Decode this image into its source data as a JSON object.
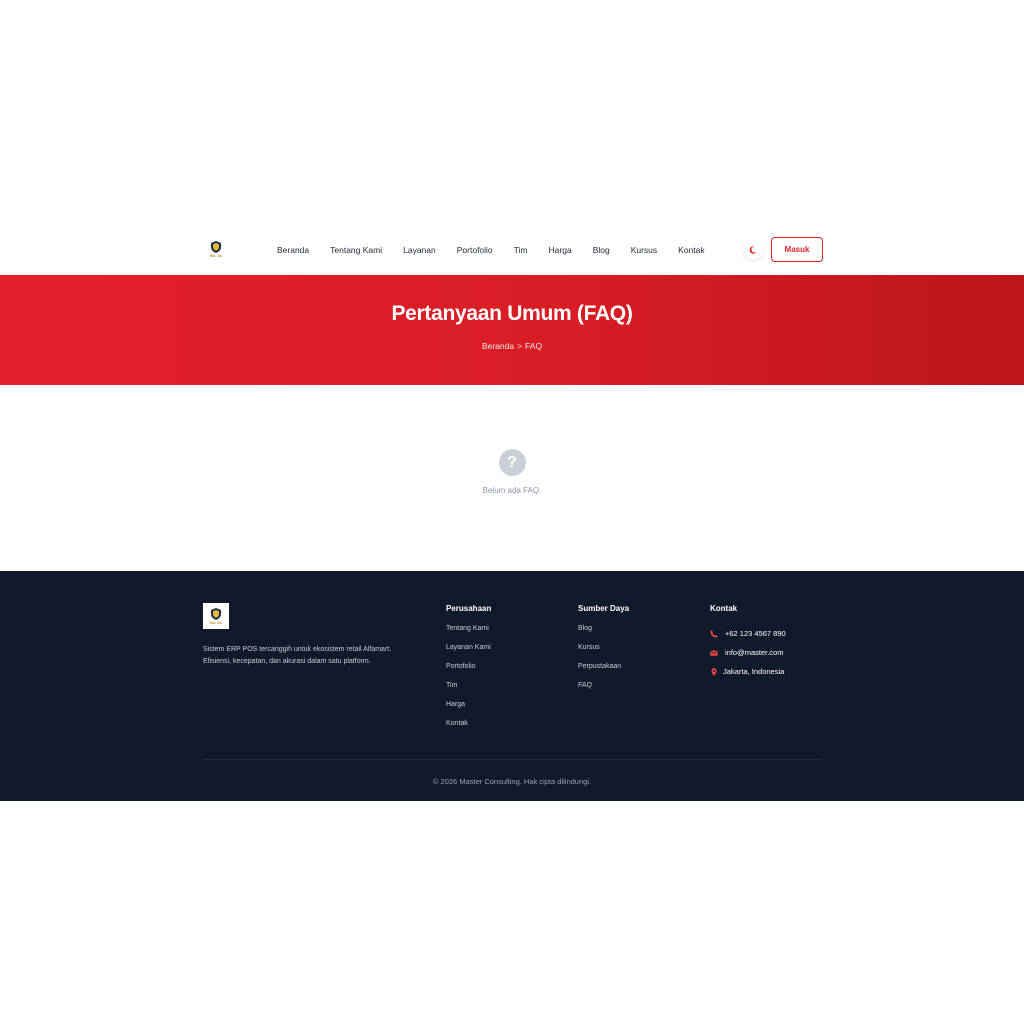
{
  "brand": {
    "logo_text": "Ba Ja"
  },
  "nav": {
    "links": [
      "Beranda",
      "Tentang Kami",
      "Layanan",
      "Portofolio",
      "Tim",
      "Harga",
      "Blog",
      "Kursus",
      "Kontak"
    ],
    "login_label": "Masuk"
  },
  "hero": {
    "title": "Pertanyaan Umum (FAQ)",
    "breadcrumb": {
      "home": "Beranda",
      "separator": ">",
      "current": "FAQ"
    }
  },
  "empty_state": {
    "message": "Belum ada FAQ."
  },
  "footer": {
    "description_line1": "Sistem ERP POS tercanggih untuk ekosistem retail Alfamart.",
    "description_line2": "Efisiensi, kecepatan, dan akurasi dalam satu platform.",
    "company": {
      "heading": "Perusahaan",
      "links": [
        "Tentang Kami",
        "Layanan Kami",
        "Portofolio",
        "Tim",
        "Harga",
        "Kontak"
      ]
    },
    "resources": {
      "heading": "Sumber Daya",
      "links": [
        "Blog",
        "Kursus",
        "Perpustakaan",
        "FAQ"
      ]
    },
    "contact": {
      "heading": "Kontak",
      "phone": "+62 123 4567 890",
      "email": "info@master.com",
      "location": "Jakarta, Indonesia"
    },
    "copyright": "© 2026 Master Consulting. Hak cipta dilindungi."
  },
  "colors": {
    "accent": "#dc2626",
    "hero_start": "#e3202a",
    "hero_end": "#bb161c",
    "footer_bg": "#111a2b"
  },
  "icons": {
    "theme_toggle": "moon-icon",
    "empty": "question-circle-icon",
    "phone": "phone-icon",
    "email": "envelope-icon",
    "location": "map-pin-icon"
  }
}
